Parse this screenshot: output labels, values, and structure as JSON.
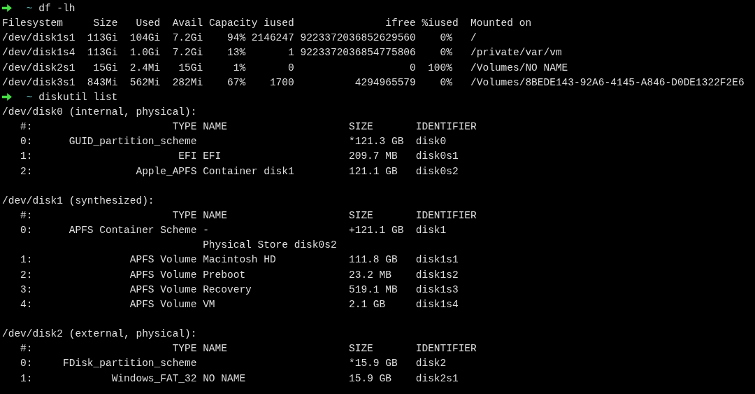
{
  "terminal": {
    "blocks": [
      {
        "kind": "command",
        "directory": "~",
        "command": "df -lh"
      },
      {
        "kind": "df_table",
        "columns": [
          "Filesystem",
          "Size",
          "Used",
          "Avail",
          "Capacity",
          "iused",
          "ifree",
          "%iused",
          "Mounted on"
        ],
        "rows": [
          [
            "/dev/disk1s1",
            "113Gi",
            "104Gi",
            "7.2Gi",
            "94%",
            "2146247",
            "9223372036852629560",
            "0%",
            "/"
          ],
          [
            "/dev/disk1s4",
            "113Gi",
            "1.0Gi",
            "7.2Gi",
            "13%",
            "1",
            "9223372036854775806",
            "0%",
            "/private/var/vm"
          ],
          [
            "/dev/disk2s1",
            "15Gi",
            "2.4Mi",
            "15Gi",
            "1%",
            "0",
            "0",
            "100%",
            "/Volumes/NO NAME"
          ],
          [
            "/dev/disk3s1",
            "843Mi",
            "562Mi",
            "282Mi",
            "67%",
            "1700",
            "4294965579",
            "0%",
            "/Volumes/8BEDE143-92A6-4145-A846-D0DE1322F2E6"
          ]
        ]
      },
      {
        "kind": "command",
        "directory": "~",
        "command": "diskutil list"
      },
      {
        "kind": "disk_list",
        "disks": [
          {
            "device": "/dev/disk0 (internal, physical):",
            "columns": [
              "#:",
              "TYPE",
              "NAME",
              "SIZE",
              "IDENTIFIER"
            ],
            "partitions": [
              {
                "index": "0:",
                "type": "GUID_partition_scheme",
                "size": "*121.3 GB",
                "identifier": "disk0"
              },
              {
                "index": "1:",
                "type": "EFI",
                "name": "EFI",
                "size": "209.7 MB",
                "identifier": "disk0s1"
              },
              {
                "index": "2:",
                "type": "Apple_APFS",
                "name": "Container disk1",
                "size": "121.1 GB",
                "identifier": "disk0s2"
              }
            ]
          },
          {
            "device": "/dev/disk1 (synthesized):",
            "columns": [
              "#:",
              "TYPE",
              "NAME",
              "SIZE",
              "IDENTIFIER"
            ],
            "partitions": [
              {
                "index": "0:",
                "type": "APFS Container Scheme",
                "name": "-",
                "size": "+121.1 GB",
                "identifier": "disk1",
                "detail": "Physical Store disk0s2"
              },
              {
                "index": "1:",
                "type": "APFS Volume",
                "name": "Macintosh HD",
                "size": "111.8 GB",
                "identifier": "disk1s1"
              },
              {
                "index": "2:",
                "type": "APFS Volume",
                "name": "Preboot",
                "size": "23.2 MB",
                "identifier": "disk1s2"
              },
              {
                "index": "3:",
                "type": "APFS Volume",
                "name": "Recovery",
                "size": "519.1 MB",
                "identifier": "disk1s3"
              },
              {
                "index": "4:",
                "type": "APFS Volume",
                "name": "VM",
                "size": "2.1 GB",
                "identifier": "disk1s4"
              }
            ]
          },
          {
            "device": "/dev/disk2 (external, physical):",
            "columns": [
              "#:",
              "TYPE",
              "NAME",
              "SIZE",
              "IDENTIFIER"
            ],
            "partitions": [
              {
                "index": "0:",
                "type": "FDisk_partition_scheme",
                "size": "*15.9 GB",
                "identifier": "disk2"
              },
              {
                "index": "1:",
                "type": "Windows_FAT_32",
                "name": "NO NAME",
                "size": "15.9 GB",
                "identifier": "disk2s1"
              }
            ]
          }
        ]
      }
    ]
  }
}
